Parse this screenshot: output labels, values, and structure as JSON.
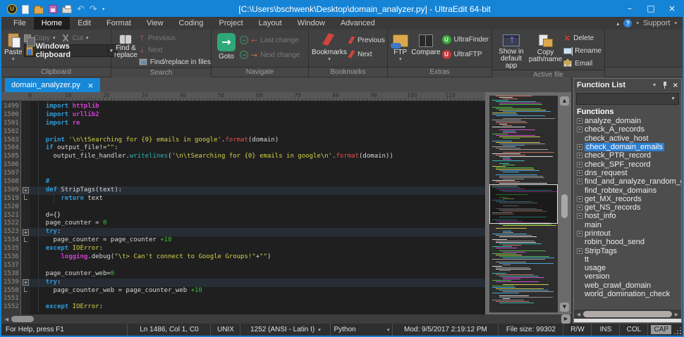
{
  "colors": {
    "accent_blue": "#1583d6",
    "tab_blue": "#1787d8",
    "selection_blue": "#2f7fd0",
    "goto_green": "#2ea878",
    "bookmark_red": "#d0443c",
    "editor_bg": "#1f1f1f",
    "keyword": "#2e9ad8",
    "module": "#cf3fcf",
    "string": "#d2d24a",
    "method_red": "#e0524a",
    "builtin_cyan": "#2ab4b4",
    "number_green": "#3dbd3d"
  },
  "titlebar": {
    "title": "[C:\\Users\\bschwenk\\Desktop\\domain_analyzer.py] - UltraEdit 64-bit",
    "icons": [
      "ultraedit-logo",
      "new-file-icon",
      "open-folder-icon",
      "save-icon",
      "print-icon",
      "undo-icon",
      "redo-icon",
      "quick-access-more-icon"
    ],
    "undo_glyph": "↶",
    "redo_glyph": "↷",
    "controls": {
      "minimize": "–",
      "maximize": "□",
      "close": "×"
    }
  },
  "menu": {
    "items": [
      "File",
      "Home",
      "Edit",
      "Format",
      "View",
      "Coding",
      "Project",
      "Layout",
      "Window",
      "Advanced"
    ],
    "active": "Home",
    "support": "Support"
  },
  "ribbon": {
    "clipboard": {
      "label": "Clipboard",
      "paste": "Paste",
      "copy": "Copy",
      "cut": "Cut",
      "windows_clipboard": "Windows clipboard"
    },
    "search": {
      "label": "Search",
      "find_replace": "Find & replace",
      "previous": "Previous",
      "next": "Next",
      "find_in_files": "Find/replace in files"
    },
    "navigate": {
      "label": "Navigate",
      "goto": "Goto",
      "last_change": "Last change",
      "next_change": "Next change"
    },
    "bookmarks": {
      "label": "Bookmarks",
      "bookmarks": "Bookmarks",
      "previous": "Previous",
      "next": "Next"
    },
    "extras": {
      "label": "Extras",
      "ftp": "FTP",
      "compare": "Compare",
      "ultrafinder": "UltraFinder",
      "ultraftp": "UltraFTP"
    },
    "active_file": {
      "label": "Active file",
      "show_in_default_app": "Show in default app",
      "copy_path_name": "Copy path/name",
      "delete": "Delete",
      "rename": "Rename",
      "email": "Email"
    }
  },
  "tab": {
    "title": "domain_analyzer.py"
  },
  "ruler": {
    "numbers": [
      0,
      10,
      20,
      30,
      40,
      50,
      60,
      70,
      80,
      90,
      100,
      110
    ]
  },
  "editor": {
    "lines": [
      {
        "n": "1499",
        "t": [
          [
            "p",
            "    "
          ],
          [
            "k",
            "import"
          ],
          [
            "m",
            " httplib"
          ]
        ]
      },
      {
        "n": "1500",
        "t": [
          [
            "p",
            "    "
          ],
          [
            "k",
            "import"
          ],
          [
            "m",
            " urllib2"
          ]
        ]
      },
      {
        "n": "1501",
        "t": [
          [
            "p",
            "    "
          ],
          [
            "k",
            "import"
          ],
          [
            "m",
            " re"
          ]
        ]
      },
      {
        "n": "1502",
        "t": []
      },
      {
        "n": "1503",
        "t": [
          [
            "p",
            "    "
          ],
          [
            "k",
            "print"
          ],
          [
            "p",
            " "
          ],
          [
            "s",
            "'\\n\\tSearching for {0} emails in google'"
          ],
          [
            "p",
            "."
          ],
          [
            "r",
            "format"
          ],
          [
            "p",
            "(domain)"
          ]
        ]
      },
      {
        "n": "1504",
        "t": [
          [
            "p",
            "    "
          ],
          [
            "k",
            "if"
          ],
          [
            "p",
            " output_file!="
          ],
          [
            "s",
            "\"\""
          ],
          [
            "p",
            ":"
          ]
        ]
      },
      {
        "n": "1505",
        "t": [
          [
            "p",
            "      output_file_handler."
          ],
          [
            "c",
            "writelines"
          ],
          [
            "p",
            "("
          ],
          [
            "s",
            "'\\n\\tSearching for {0} emails in google\\n'"
          ],
          [
            "p",
            "."
          ],
          [
            "r",
            "format"
          ],
          [
            "p",
            "(domain))"
          ]
        ]
      },
      {
        "n": "1506",
        "t": []
      },
      {
        "n": "1507",
        "t": []
      },
      {
        "n": "1508",
        "t": [
          [
            "p",
            "    "
          ],
          [
            "k",
            "#"
          ]
        ]
      },
      {
        "n": "1509",
        "f": "start",
        "h": true,
        "t": [
          [
            "p",
            "    "
          ],
          [
            "k",
            "def"
          ],
          [
            "p",
            " StripTags(text):"
          ]
        ]
      },
      {
        "n": "1519",
        "f": "end",
        "g": 2,
        "t": [
          [
            "p",
            "        "
          ],
          [
            "k",
            "return"
          ],
          [
            "p",
            " text"
          ]
        ]
      },
      {
        "n": "1520",
        "t": []
      },
      {
        "n": "1521",
        "t": [
          [
            "p",
            "    d={}"
          ]
        ]
      },
      {
        "n": "1522",
        "t": [
          [
            "p",
            "    page_counter = "
          ],
          [
            "n2",
            "0"
          ]
        ]
      },
      {
        "n": "1523",
        "f": "start",
        "h": true,
        "t": [
          [
            "p",
            "    "
          ],
          [
            "k",
            "try"
          ],
          [
            "p",
            ":"
          ]
        ]
      },
      {
        "n": "1534",
        "f": "end",
        "t": [
          [
            "p",
            "      page_counter = page_counter "
          ],
          [
            "n2",
            "+10"
          ]
        ]
      },
      {
        "n": "1535",
        "t": [
          [
            "p",
            "    "
          ],
          [
            "k",
            "except"
          ],
          [
            "p",
            " "
          ],
          [
            "s",
            "IOError"
          ],
          [
            "p",
            ":"
          ]
        ]
      },
      {
        "n": "1536",
        "t": [
          [
            "p",
            "        "
          ],
          [
            "m",
            "logging"
          ],
          [
            "p",
            ".debug("
          ],
          [
            "s",
            "\"\\t> Can't connect to Google Groups!\""
          ],
          [
            "p",
            "+"
          ],
          [
            "s",
            "\"\""
          ],
          [
            "p",
            ")"
          ]
        ]
      },
      {
        "n": "1537",
        "t": []
      },
      {
        "n": "1538",
        "t": [
          [
            "p",
            "    page_counter_web="
          ],
          [
            "n2",
            "0"
          ]
        ]
      },
      {
        "n": "1539",
        "f": "start",
        "h": true,
        "t": [
          [
            "p",
            "    "
          ],
          [
            "k",
            "try"
          ],
          [
            "p",
            ":"
          ]
        ]
      },
      {
        "n": "1550",
        "f": "end",
        "t": [
          [
            "p",
            "      page_counter_web = page_counter_web "
          ],
          [
            "n2",
            "+10"
          ]
        ]
      },
      {
        "n": "1551",
        "t": []
      },
      {
        "n": "1552",
        "t": [
          [
            "p",
            "    "
          ],
          [
            "k",
            "except"
          ],
          [
            "p",
            " "
          ],
          [
            "s",
            "IOError"
          ],
          [
            "p",
            ":"
          ]
        ]
      }
    ]
  },
  "function_list": {
    "title": "Function List",
    "category": "Functions",
    "filter_value": "",
    "items": [
      {
        "label": "analyze_domain",
        "exp": true
      },
      {
        "label": "check_A_records",
        "exp": true
      },
      {
        "label": "check_active_host",
        "exp": false
      },
      {
        "label": "check_domain_emails",
        "exp": true,
        "selected": true
      },
      {
        "label": "check_PTR_record",
        "exp": true
      },
      {
        "label": "check_SPF_record",
        "exp": true
      },
      {
        "label": "dns_request",
        "exp": true
      },
      {
        "label": "find_and_analyze_random_domain",
        "exp": true
      },
      {
        "label": "find_robtex_domains",
        "exp": false
      },
      {
        "label": "get_MX_records",
        "exp": true
      },
      {
        "label": "get_NS_records",
        "exp": true
      },
      {
        "label": "host_info",
        "exp": true
      },
      {
        "label": "main",
        "exp": false
      },
      {
        "label": "printout",
        "exp": true
      },
      {
        "label": "robin_hood_send",
        "exp": false
      },
      {
        "label": "StripTags",
        "exp": true
      },
      {
        "label": "tt",
        "exp": false
      },
      {
        "label": "usage",
        "exp": false
      },
      {
        "label": "version",
        "exp": false
      },
      {
        "label": "web_crawl_domain",
        "exp": false
      },
      {
        "label": "world_domination_check",
        "exp": false
      }
    ]
  },
  "status": {
    "help": "For Help, press F1",
    "position": "Ln 1486, Col 1, C0",
    "line_ending": "UNIX",
    "encoding": "1252  (ANSI - Latin I)",
    "language": "Python",
    "modified": "Mod: 9/5/2017 2:19:12 PM",
    "file_size": "File size: 99302",
    "read_write": "R/W",
    "insert_mode": "INS",
    "column_mode": "COL",
    "caps": "CAP"
  }
}
